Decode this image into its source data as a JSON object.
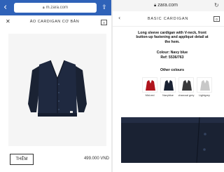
{
  "left": {
    "url": "m.zara.com",
    "title": "ÁO CARDIGAN CƠ BẢN",
    "cart_count": "0",
    "add_button": "THÊM",
    "price": "499.000 VND"
  },
  "right": {
    "url": "zara.com",
    "title": "BASIC CARDIGAN",
    "cart_count": "0",
    "description": "Long sleeve cardigan with V-neck, front button-up fastening and appliqué detail at the hem.",
    "colour": "Colour: Navy blue",
    "ref": "Ref: 5536/763",
    "other_colours_heading": "Other colours",
    "swatches": [
      {
        "label": "Mid-red",
        "color": "#b0141d"
      },
      {
        "label": "Navyblue",
        "color": "#1a2233"
      },
      {
        "label": "charcoal grey",
        "color": "#3a3a3c"
      },
      {
        "label": "Lightgrey",
        "color": "#c8c8c8"
      }
    ]
  },
  "colors": {
    "left_urlbar": "#2f62b8",
    "garment_navy": "#1a2233"
  }
}
